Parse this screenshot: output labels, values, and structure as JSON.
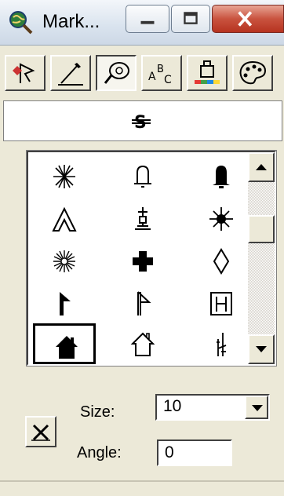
{
  "window": {
    "title": "Mark...",
    "icon": "magnifier-globe-icon",
    "controls": [
      "minimize-icon",
      "maximize-icon",
      "close-icon"
    ]
  },
  "toolbar": {
    "tools": [
      {
        "icon": "marker-symbol-icon",
        "pressed": false
      },
      {
        "icon": "line-symbol-icon",
        "pressed": false
      },
      {
        "icon": "fill-symbol-icon",
        "pressed": true
      },
      {
        "icon": "text-symbol-icon",
        "pressed": false
      },
      {
        "icon": "color-icon",
        "pressed": false
      },
      {
        "icon": "palette-icon",
        "pressed": false
      }
    ]
  },
  "preview": {
    "symbol": "strikethrough-s-icon"
  },
  "gallery": {
    "symbols": [
      "asterisk-burst-icon",
      "bell-outline-icon",
      "bell-filled-icon",
      "chevron-up-outline-icon",
      "anchor-cross-icon",
      "star-burst-icon",
      "sparkle-burst-icon",
      "cross-filled-icon",
      "diamond-outline-icon",
      "flag-filled-icon",
      "flag-outline-icon",
      "h-box-icon",
      "house-filled-icon",
      "house-outline-icon",
      "tower-icon"
    ],
    "selected_index": 12
  },
  "controls": {
    "size_label": "Size:",
    "size_value": "10",
    "angle_label": "Angle:",
    "angle_value": "0",
    "clear_icon": "x-icon"
  },
  "colors": {
    "window_bg": "#ece9d8",
    "close_button": "#c9533f"
  }
}
